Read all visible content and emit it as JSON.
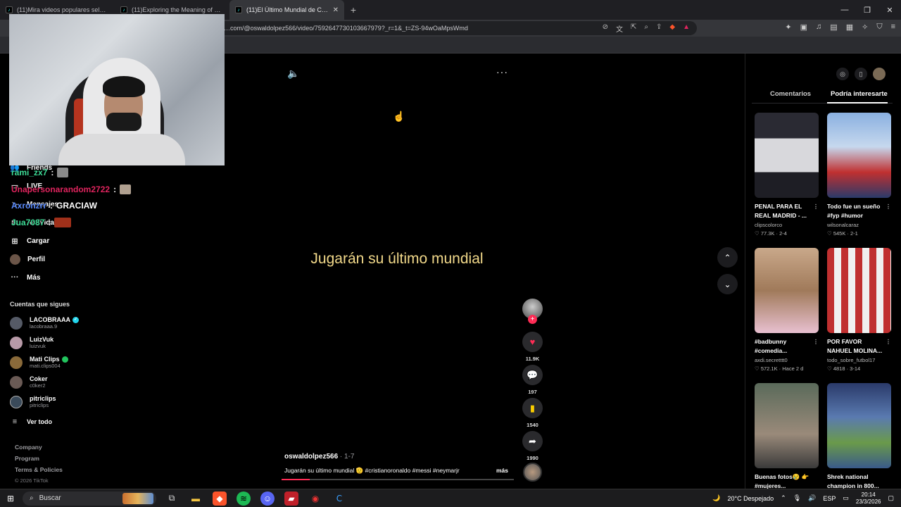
{
  "browser": {
    "tabs": [
      {
        "title": "(11)Mira videos populares seleccionados",
        "active": false
      },
      {
        "title": "(11)Exploring the Meaning of Peace",
        "active": false
      },
      {
        "title": "(11)El Último Mundial de Cristiano",
        "active": true
      }
    ],
    "new_tab": "+",
    "url": "…com/@oswaldolpez566/video/7592647730103667979?_r=1&_t=ZS-94wOaMpsWmd"
  },
  "sidebar": {
    "items": [
      {
        "label": "Friends",
        "icon": "friends-icon"
      },
      {
        "label": "LIVE",
        "icon": "live-icon"
      },
      {
        "label": "Mensajes",
        "icon": "messages-icon"
      },
      {
        "label": "Actividad",
        "icon": "activity-icon"
      },
      {
        "label": "Cargar",
        "icon": "upload-icon"
      },
      {
        "label": "Perfil",
        "icon": "profile-icon"
      },
      {
        "label": "Más",
        "icon": "more-icon"
      }
    ],
    "following_title": "Cuentas que sigues",
    "following": [
      {
        "name": "LACOBRAAA",
        "user": "lacobraaa.9",
        "badge": "verified",
        "color": "#555a66"
      },
      {
        "name": "LuizVuk",
        "user": "luizvuk",
        "badge": "",
        "color": "#b89aa8"
      },
      {
        "name": "Mati Clips",
        "user": "mati.clips004",
        "badge": "live",
        "color": "#8a6a3a"
      },
      {
        "name": "Coker",
        "user": "c0ker2",
        "badge": "",
        "color": "#6a5a55"
      },
      {
        "name": "pitriclips",
        "user": "pitriclips",
        "badge": "",
        "color": "#3a4a5a"
      }
    ],
    "see_all": "Ver todo",
    "footer": [
      "Company",
      "Program",
      "Terms & Policies"
    ],
    "copyright": "© 2026 TikTok"
  },
  "chat": [
    {
      "user": "rami_zx7",
      "sep": " :",
      "text": "",
      "color": "#3ddc97",
      "emote": "#8a8a8a"
    },
    {
      "user": "Unapersonarandom2722",
      "sep": " :",
      "text": "",
      "color": "#e0245e",
      "emote": "#b0a090"
    },
    {
      "user": "Axronzrr",
      "sep": ":",
      "text": "GRACIAW",
      "color": "#5b8cff",
      "emote": ""
    },
    {
      "user": "Jua7087",
      "sep": " :",
      "text": "",
      "color": "#3ddc97",
      "emote": "#a0301a"
    }
  ],
  "video": {
    "caption": "Jugarán su último mundial",
    "author": "oswaldolpez566",
    "date": " · 1-7",
    "description": "Jugarán su último mundial 🫡 #cristianoronaldo #messi #neymarjr",
    "more": "más",
    "progress": 0.12,
    "likes": "11.9K",
    "comments": "197",
    "saves": "1540",
    "shares": "1990"
  },
  "right_panel": {
    "tabs": [
      "Comentarios",
      "Podría interesarte"
    ],
    "active_tab": "Podría interesarte",
    "cards": [
      {
        "title": "PENAL PARA EL REAL MADRID - ...",
        "user": "clipscolorco",
        "likes": "77.3K",
        "date": "2-4",
        "thumb": "#2a2a33"
      },
      {
        "title": "Todo fue un sueño #fyp #humor",
        "user": "wilsonalcaraz",
        "likes": "545K",
        "date": "2-1",
        "thumb": "#4a6aa0"
      },
      {
        "title": "#badbunny #comedia...",
        "user": "axdi.secretttt0",
        "likes": "572.1K",
        "date": "Hace 2 d",
        "thumb": "#8a6a50"
      },
      {
        "title": "POR FAVOR NAHUEL MOLINA...",
        "user": "todo_sobre_futbol17",
        "likes": "4818",
        "date": "3-14",
        "thumb": "#8a3a3a"
      },
      {
        "title": "Buenas fotos😢 👉 #mujeres...",
        "user": "",
        "likes": "",
        "date": "",
        "thumb": "#3a4a3a"
      },
      {
        "title": "Shrek national champion in 800...",
        "user": "",
        "likes": "",
        "date": "",
        "thumb": "#3a5a8a"
      }
    ]
  },
  "taskbar": {
    "search": "Buscar",
    "weather": "20°C  Despejado",
    "lang": "ESP",
    "time": "20:14",
    "date": "23/3/2026"
  },
  "colors": {
    "accent": "#fe2c55",
    "caption": "#f2d98a",
    "save": "#facd00"
  }
}
